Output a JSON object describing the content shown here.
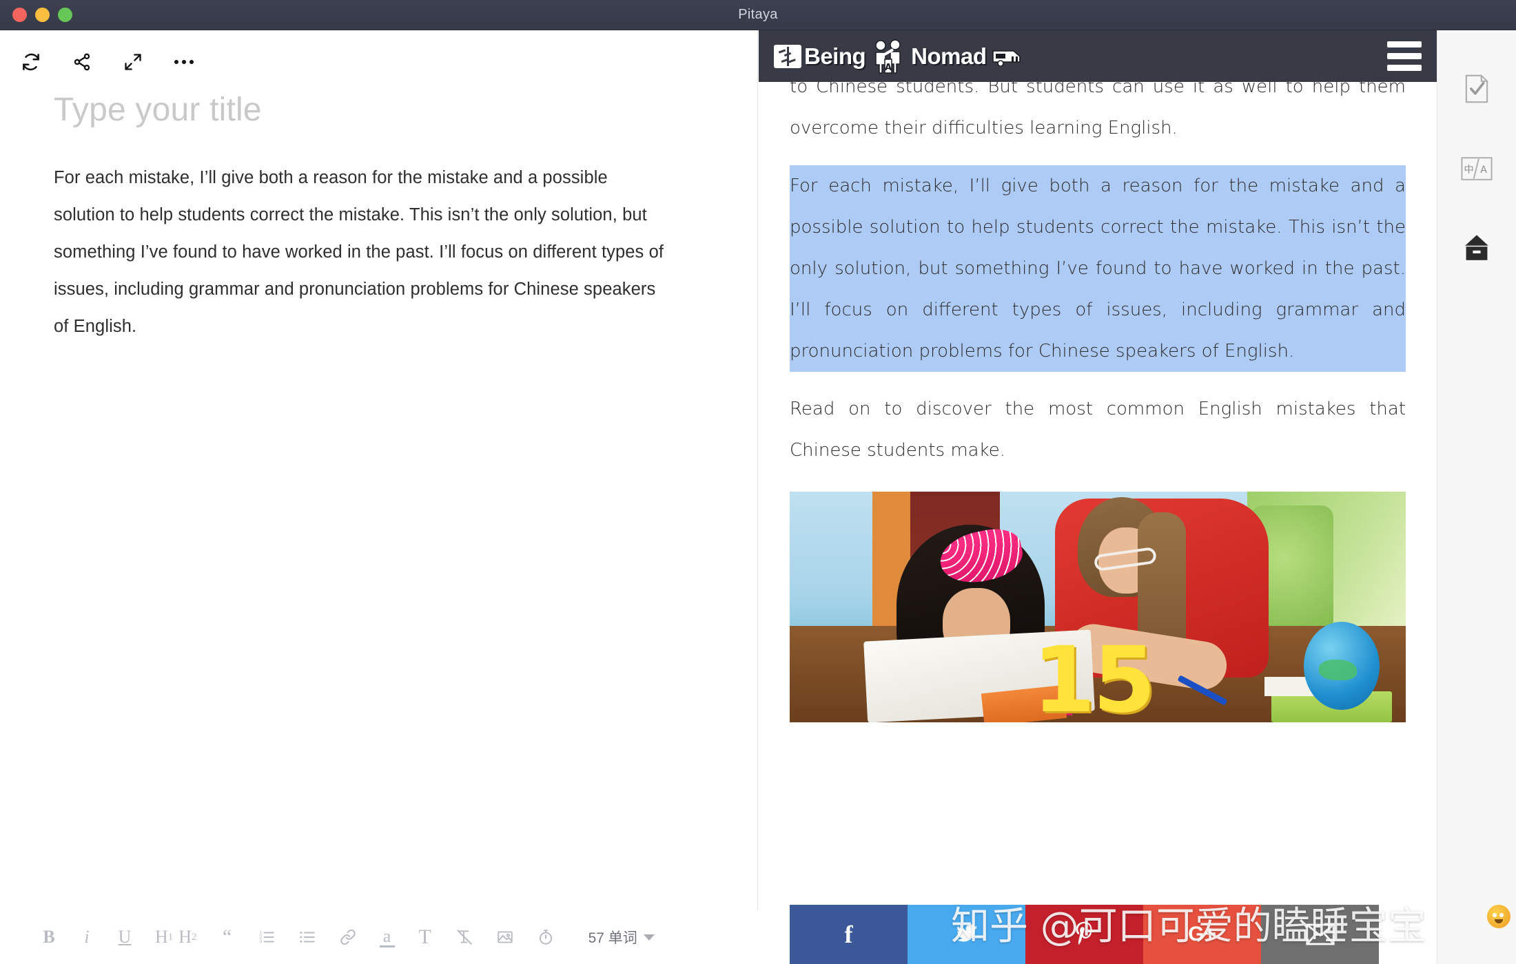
{
  "window": {
    "title": "Pitaya",
    "traffic_lights": [
      "close",
      "minimize",
      "zoom"
    ]
  },
  "editor": {
    "toolbar": [
      {
        "name": "sync-icon",
        "label": "Sync"
      },
      {
        "name": "share-icon",
        "label": "Share"
      },
      {
        "name": "fullscreen-icon",
        "label": "Fullscreen"
      },
      {
        "name": "more-icon",
        "label": "More"
      }
    ],
    "title_placeholder": "Type your title",
    "body": "For each mistake, I’ll give both a reason for the mistake and a possible solution to help students correct the mistake. This isn’t the only solution, but something I’ve found to have worked in the past. I’ll focus on different types of issues, including grammar and pronunciation problems for Chinese speakers of English.",
    "format_bar": {
      "bold": "B",
      "italic": "i",
      "underline": "U",
      "h1": "H",
      "h1_sub": "1",
      "h2": "H",
      "h2_sub": "2",
      "quote": "“",
      "ordered_list": "ordered-list-icon",
      "bullet_list": "bullet-list-icon",
      "link": "link-icon",
      "text_color": "a",
      "font_size": "T",
      "clear_format": "clear-format-icon",
      "image": "image-icon",
      "timer": "timer-icon",
      "word_count": "57 单词"
    }
  },
  "preview": {
    "site_header": {
      "brand_text_1": "Being",
      "brand_text_2": "Nomad",
      "brand_letter": "A",
      "menu": "hamburger-menu-icon"
    },
    "paragraphs": [
      {
        "id": "p1",
        "text": "to Chinese students. But students can use it as well to help them overcome their difficulties learning English.",
        "selected": false
      },
      {
        "id": "p2",
        "text": "For each mistake, I’ll give both a reason for the mistake and a possible solution to help students correct the mistake. This isn’t the only solution, but something I’ve found to have worked in the past. I’ll focus on different types of issues, including grammar and pronunciation problems for Chinese speakers of English.",
        "selected": true
      },
      {
        "id": "p3",
        "text": "Read on to discover the most common English mistakes that Chinese students make.",
        "selected": false
      }
    ],
    "figure": {
      "alt": "Teacher helping a young girl with her homework at a desk",
      "overlay_number": "15"
    },
    "social_buttons": [
      {
        "name": "facebook-share-button",
        "label": "f"
      },
      {
        "name": "twitter-share-button",
        "label": "twitter-icon"
      },
      {
        "name": "pinterest-share-button",
        "label": "pinterest-icon"
      },
      {
        "name": "googleplus-share-button",
        "label": "G+"
      },
      {
        "name": "email-share-button",
        "label": "envelope-icon"
      }
    ],
    "watermark": "知乎 @可口可爱的瞌睡宝宝"
  },
  "right_rail": [
    {
      "name": "proofread-icon",
      "label": "Proofread"
    },
    {
      "name": "translate-icon",
      "label": "Translate",
      "glyph_cn": "中",
      "glyph_en": "A"
    },
    {
      "name": "publish-box-icon",
      "label": "Publish"
    }
  ],
  "colors": {
    "titlebar": "#3d4050",
    "site_header": "#383b46",
    "selection": "#aecbf5",
    "facebook": "#3b5998",
    "twitter": "#49a9ef",
    "pinterest": "#c3202b",
    "googleplus": "#e5503f",
    "email": "#6f6f6f",
    "overlay_number": "#ffe23a"
  }
}
